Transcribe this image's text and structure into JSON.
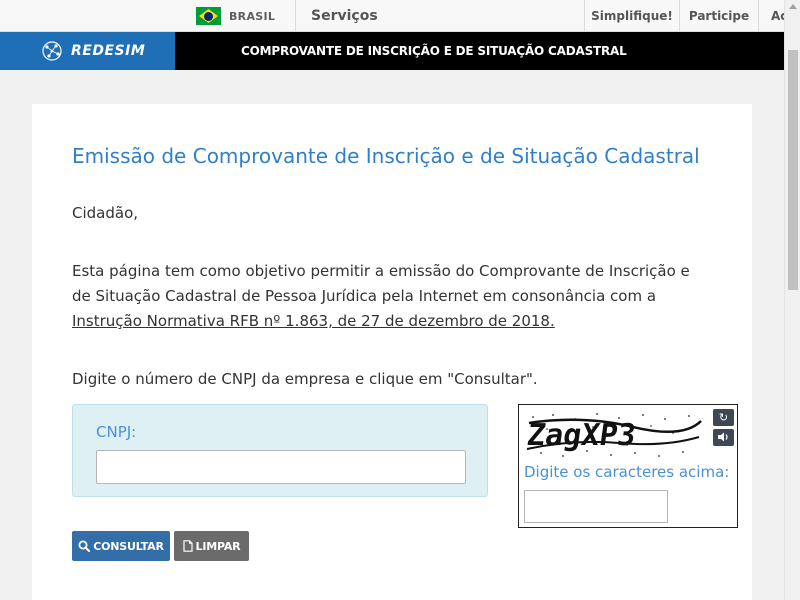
{
  "gov_bar": {
    "country_label": "BRASIL",
    "services_label": "Serviços",
    "simplifique_label": "Simplifique!",
    "participe_label": "Participe",
    "acesso_label": "Acesso à informação"
  },
  "header": {
    "logo_text": "REDESIM",
    "title": "COMPROVANTE DE INSCRIÇÃO E DE SITUAÇÃO CADASTRAL"
  },
  "main": {
    "title": "Emissão de Comprovante de Inscrição e de Situação Cadastral",
    "greeting": "Cidadão,",
    "intro_text": "Esta página tem como objetivo permitir a emissão do Comprovante de Inscrição e de Situação Cadastral de Pessoa Jurídica pela Internet em consonância com a ",
    "intro_link": "Instrução Normativa RFB nº 1.863, de 27 de dezembro de 2018.",
    "instruction": "Digite o número de CNPJ da empresa e clique em \"Consultar\".",
    "cnpj_label": "CNPJ:",
    "cnpj_value": "",
    "captcha_text": "ZagXP3",
    "captcha_label": "Digite os caracteres acima:",
    "captcha_value": "",
    "consultar_label": "CONSULTAR",
    "limpar_label": "LIMPAR"
  },
  "colors": {
    "accent": "#2f80c9",
    "logo_bg": "#1f6fb7",
    "consultar_bg": "#336ea8",
    "limpar_bg": "#6b6b6b",
    "cnpj_box_bg": "#dff0f5"
  },
  "icons": [
    "brazil-flag-icon",
    "redesim-logo-icon",
    "refresh-icon",
    "audio-icon",
    "search-icon",
    "document-icon"
  ]
}
